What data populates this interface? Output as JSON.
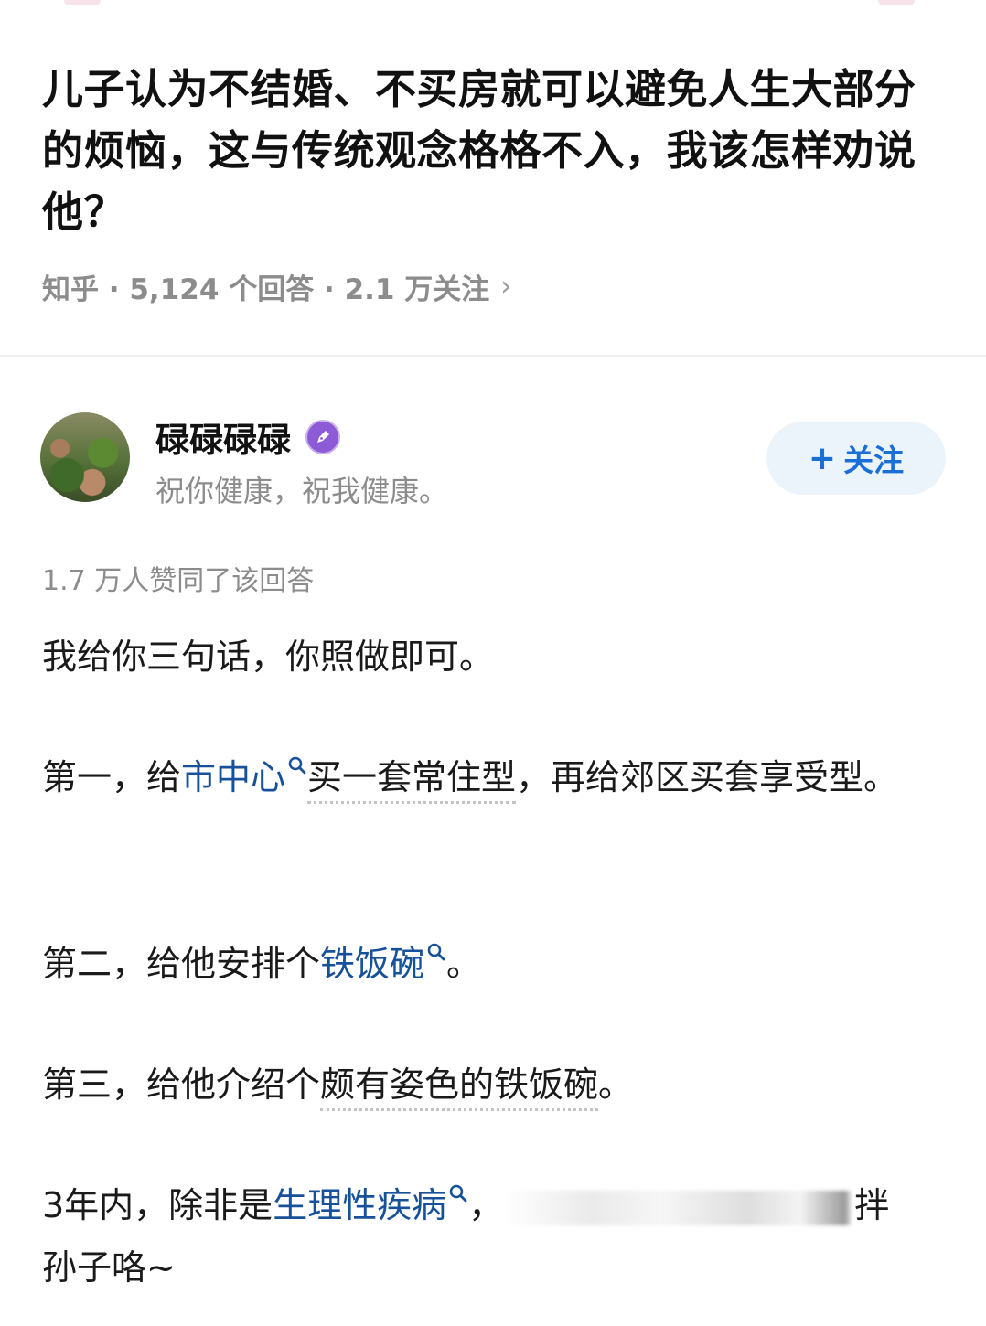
{
  "question": {
    "title": "儿子认为不结婚、不买房就可以避免人生大部分的烦恼，这与传统观念格格不入，我该怎样劝说他？",
    "meta": "知乎 · 5,124 个回答 · 2.1 万关注"
  },
  "author": {
    "name": "碌碌碌碌",
    "bio": "祝你健康，祝我健康。",
    "follow_plus": "+",
    "follow_label": "关注"
  },
  "answer": {
    "vote_text": "1.7 万人赞同了该回答",
    "p1": "我给你三句话，你照做即可。",
    "p2_a": "第一，给",
    "p2_link": "市中心",
    "p2_b": "买一套常住型",
    "p2_c": "，再给郊区买套享受型。",
    "p3_a": "第二，给他安排个",
    "p3_link": "铁饭碗",
    "p3_b": "。",
    "p4_a": "第三，给他介绍个",
    "p4_b": "颇有姿色的铁饭碗",
    "p4_c": "。",
    "p5_a": "3年内，除非是",
    "p5_link": "生理性疾病",
    "p5_b": "，",
    "p5_c": "拌",
    "p5_d": "孙子咯~"
  }
}
